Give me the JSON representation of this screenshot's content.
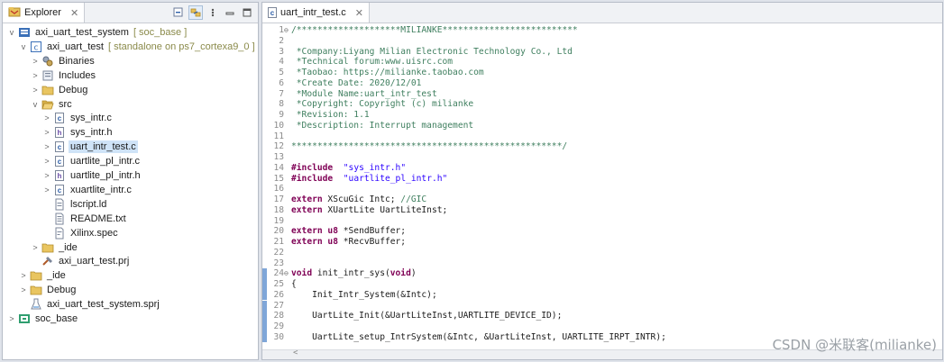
{
  "explorer": {
    "tab_label": "Explorer",
    "tree": [
      {
        "indent": 0,
        "twisty": "v",
        "icon": "system-project-icon",
        "label": "axi_uart_test_system",
        "deco": "[ soc_base ]",
        "sel": false
      },
      {
        "indent": 1,
        "twisty": "v",
        "icon": "app-project-icon",
        "label": "axi_uart_test",
        "deco": "[ standalone on ps7_cortexa9_0 ]",
        "sel": false
      },
      {
        "indent": 2,
        "twisty": ">",
        "icon": "binaries-icon",
        "label": "Binaries",
        "deco": "",
        "sel": false
      },
      {
        "indent": 2,
        "twisty": ">",
        "icon": "includes-icon",
        "label": "Includes",
        "deco": "",
        "sel": false
      },
      {
        "indent": 2,
        "twisty": ">",
        "icon": "folder-icon",
        "label": "Debug",
        "deco": "",
        "sel": false
      },
      {
        "indent": 2,
        "twisty": "v",
        "icon": "folder-open-icon",
        "label": "src",
        "deco": "",
        "sel": false
      },
      {
        "indent": 3,
        "twisty": ">",
        "icon": "c-file-icon",
        "label": "sys_intr.c",
        "deco": "",
        "sel": false
      },
      {
        "indent": 3,
        "twisty": ">",
        "icon": "h-file-icon",
        "label": "sys_intr.h",
        "deco": "",
        "sel": false
      },
      {
        "indent": 3,
        "twisty": ">",
        "icon": "c-file-icon",
        "label": "uart_intr_test.c",
        "deco": "",
        "sel": true
      },
      {
        "indent": 3,
        "twisty": ">",
        "icon": "c-file-icon",
        "label": "uartlite_pl_intr.c",
        "deco": "",
        "sel": false
      },
      {
        "indent": 3,
        "twisty": ">",
        "icon": "h-file-icon",
        "label": "uartlite_pl_intr.h",
        "deco": "",
        "sel": false
      },
      {
        "indent": 3,
        "twisty": ">",
        "icon": "c-file-icon",
        "label": "xuartlite_intr.c",
        "deco": "",
        "sel": false
      },
      {
        "indent": 3,
        "twisty": "",
        "icon": "ld-file-icon",
        "label": "lscript.ld",
        "deco": "",
        "sel": false
      },
      {
        "indent": 3,
        "twisty": "",
        "icon": "text-file-icon",
        "label": "README.txt",
        "deco": "",
        "sel": false
      },
      {
        "indent": 3,
        "twisty": "",
        "icon": "spec-file-icon",
        "label": "Xilinx.spec",
        "deco": "",
        "sel": false
      },
      {
        "indent": 2,
        "twisty": ">",
        "icon": "folder-icon",
        "label": "_ide",
        "deco": "",
        "sel": false
      },
      {
        "indent": 2,
        "twisty": "",
        "icon": "prj-file-icon",
        "label": "axi_uart_test.prj",
        "deco": "",
        "sel": false
      },
      {
        "indent": 1,
        "twisty": ">",
        "icon": "folder-icon",
        "label": "_ide",
        "deco": "",
        "sel": false
      },
      {
        "indent": 1,
        "twisty": ">",
        "icon": "folder-icon",
        "label": "Debug",
        "deco": "",
        "sel": false
      },
      {
        "indent": 1,
        "twisty": "",
        "icon": "sprj-file-icon",
        "label": "axi_uart_test_system.sprj",
        "deco": "",
        "sel": false
      },
      {
        "indent": 0,
        "twisty": ">",
        "icon": "platform-icon",
        "label": "soc_base",
        "deco": "",
        "sel": false
      }
    ]
  },
  "editor": {
    "tab_label": "uart_intr_test.c",
    "lines": [
      {
        "n": "1",
        "fold": "⊖",
        "segs": [
          [
            "cm",
            "/********************MILIANKE**************************"
          ]
        ]
      },
      {
        "n": "2",
        "segs": []
      },
      {
        "n": "3",
        "segs": [
          [
            "cm",
            " *Company:Liyang Milian Electronic Technology Co., Ltd"
          ]
        ]
      },
      {
        "n": "4",
        "segs": [
          [
            "cm",
            " *Technical forum:www.uisrc.com"
          ]
        ]
      },
      {
        "n": "5",
        "segs": [
          [
            "cm",
            " *Taobao: https://milianke.taobao.com"
          ]
        ]
      },
      {
        "n": "6",
        "segs": [
          [
            "cm",
            " *Create Date: 2020/12/01"
          ]
        ]
      },
      {
        "n": "7",
        "segs": [
          [
            "cm",
            " *Module Name:uart_intr_test"
          ]
        ]
      },
      {
        "n": "8",
        "segs": [
          [
            "cm",
            " *Copyright: Copyright (c) milianke"
          ]
        ]
      },
      {
        "n": "9",
        "segs": [
          [
            "cm",
            " *Revision: 1.1"
          ]
        ]
      },
      {
        "n": "10",
        "segs": [
          [
            "cm",
            " *Description: Interrupt management"
          ]
        ]
      },
      {
        "n": "11",
        "segs": []
      },
      {
        "n": "12",
        "segs": [
          [
            "cm",
            "****************************************************/"
          ]
        ]
      },
      {
        "n": "13",
        "segs": []
      },
      {
        "n": "14",
        "segs": [
          [
            "kw",
            "#include"
          ],
          [
            "",
            "  "
          ],
          [
            "str",
            "\"sys_intr.h\""
          ]
        ]
      },
      {
        "n": "15",
        "segs": [
          [
            "kw",
            "#include"
          ],
          [
            "",
            "  "
          ],
          [
            "str",
            "\"uartlite_pl_intr.h\""
          ]
        ]
      },
      {
        "n": "16",
        "segs": []
      },
      {
        "n": "17",
        "segs": [
          [
            "kw",
            "extern"
          ],
          [
            "",
            " XScuGic Intc; "
          ],
          [
            "cm",
            "//GIC"
          ]
        ]
      },
      {
        "n": "18",
        "segs": [
          [
            "kw",
            "extern"
          ],
          [
            "",
            " XUartLite UartLiteInst;"
          ]
        ]
      },
      {
        "n": "19",
        "segs": []
      },
      {
        "n": "20",
        "segs": [
          [
            "kw",
            "extern"
          ],
          [
            "kw",
            " u8"
          ],
          [
            "",
            " *SendBuffer;"
          ]
        ]
      },
      {
        "n": "21",
        "segs": [
          [
            "kw",
            "extern"
          ],
          [
            "kw",
            " u8"
          ],
          [
            "",
            " *RecvBuffer;"
          ]
        ]
      },
      {
        "n": "22",
        "segs": []
      },
      {
        "n": "23",
        "segs": []
      },
      {
        "n": "24",
        "fold": "⊖",
        "hl": true,
        "segs": [
          [
            "kw",
            "void"
          ],
          [
            "",
            " init_intr_sys("
          ],
          [
            "kw",
            "void"
          ],
          [
            "",
            ")"
          ]
        ]
      },
      {
        "n": "25",
        "hl": true,
        "segs": [
          [
            "",
            "{"
          ]
        ]
      },
      {
        "n": "26",
        "hl": true,
        "segs": [
          [
            "",
            "    Init_Intr_System(&Intc);"
          ]
        ]
      },
      {
        "n": "27",
        "hl": true,
        "segs": []
      },
      {
        "n": "28",
        "hl": true,
        "segs": [
          [
            "",
            "    UartLite_Init(&UartLiteInst,UARTLITE_DEVICE_ID);"
          ]
        ]
      },
      {
        "n": "29",
        "hl": true,
        "segs": []
      },
      {
        "n": "30",
        "hl": true,
        "segs": [
          [
            "",
            "    UartLite_setup_IntrSystem(&Intc, &UartLiteInst, UARTLITE_IRPT_INTR);"
          ]
        ]
      }
    ],
    "scroll_hint": "<"
  },
  "watermark": "CSDN @米联客(milianke)"
}
